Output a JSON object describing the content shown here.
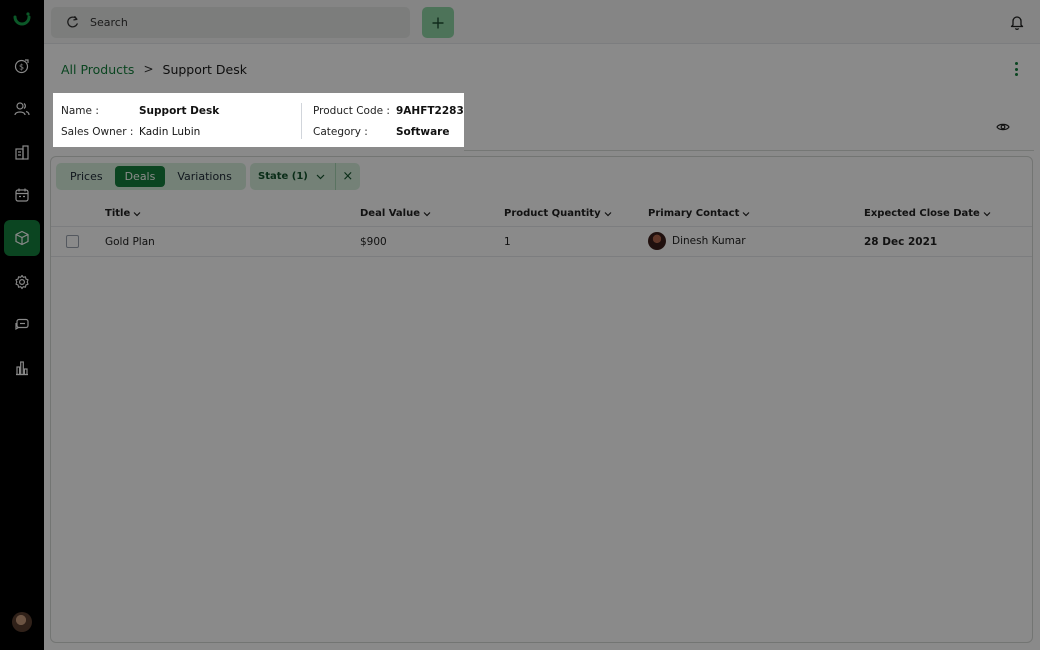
{
  "search": {
    "placeholder": "Search"
  },
  "breadcrumb": {
    "parent": "All Products",
    "separator": ">",
    "current": "Support Desk"
  },
  "info": {
    "name_label": "Name :",
    "name_value": "Support Desk",
    "owner_label": "Sales Owner :",
    "owner_value": "Kadin Lubin",
    "code_label": "Product Code :",
    "code_value": "9AHFT2283",
    "category_label": "Category :",
    "category_value": "Software"
  },
  "tabs": {
    "prices": "Prices",
    "deals": "Deals",
    "variations": "Variations",
    "active": "Deals"
  },
  "filter": {
    "label": "State (1)",
    "clear": "×"
  },
  "table": {
    "columns": [
      "Title",
      "Deal Value",
      "Product Quantity",
      "Primary Contact",
      "Expected Close Date"
    ],
    "rows": [
      {
        "title": "Gold Plan",
        "deal_value": "$900",
        "quantity": "1",
        "contact": "Dinesh Kumar",
        "close_date": "28 Dec 2021"
      }
    ]
  },
  "colors": {
    "brand": "#15803d",
    "accent_light": "#d6efdc",
    "sidebar": "#000000"
  },
  "icons": [
    "logo-icon",
    "dollar-target-icon",
    "users-icon",
    "building-icon",
    "calendar-icon",
    "package-icon",
    "gear-icon",
    "chat-icon",
    "bar-chart-icon",
    "search-icon",
    "plus-icon",
    "bell-icon",
    "kebab-icon",
    "eye-icon",
    "chevron-down-icon",
    "close-icon"
  ]
}
